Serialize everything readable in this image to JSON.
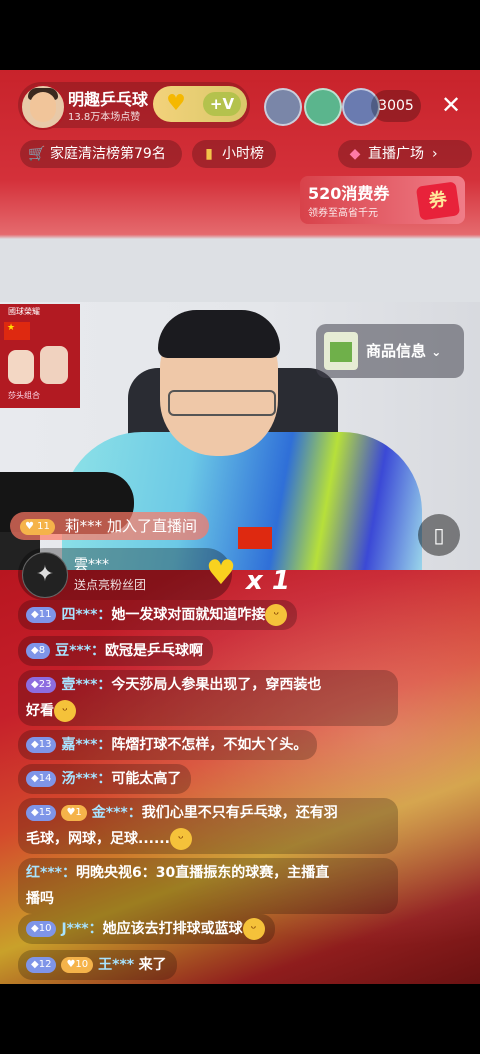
{
  "anchor": {
    "name": "明趣乒乓球",
    "likes": "13.8万本场点赞"
  },
  "viewers": {
    "count": "3005",
    "avatars": [
      "viewer-avatar-1",
      "viewer-avatar-2",
      "viewer-avatar-3"
    ]
  },
  "top_tags": {
    "rank_text": "家庭清洁榜第79名",
    "hourly_text": "小时榜",
    "plaza_text": "直播广场"
  },
  "coupon": {
    "title": "520消费券",
    "subtitle": "领券至高省千元",
    "tag": "券"
  },
  "goods": {
    "label": "商品信息"
  },
  "join": {
    "level": "11",
    "text": "莉*** 加入了直播间"
  },
  "fans": {
    "name": "雲***",
    "action": "送点亮粉丝团",
    "combo": "x 1"
  },
  "chat": [
    {
      "level": "11",
      "level_color": "blue",
      "user": "四***：",
      "content": "她一发球对面就知道咋接",
      "emoji": true
    },
    {
      "level": "8",
      "level_color": "blue",
      "user": "豆***：",
      "content": "欧冠是乒乓球啊",
      "emoji": false
    },
    {
      "level": "23",
      "level_color": "purple",
      "user": "壹***：",
      "content": "今天莎局人参果出现了，穿西装也",
      "content2": "好看",
      "emoji": true
    },
    {
      "level": "13",
      "level_color": "blue",
      "user": "嘉***：",
      "content": "阵熠打球不怎样，不如大丫头。",
      "emoji": false
    },
    {
      "level": "14",
      "level_color": "blue",
      "user": "汤***：",
      "content": "可能太高了",
      "emoji": false
    },
    {
      "level": "15",
      "level_color": "blue",
      "badge": "1",
      "user": "金***：",
      "content": "我们心里不只有乒乓球，还有羽",
      "content2": "毛球，网球，足球......",
      "emoji": true
    },
    {
      "level": "",
      "user": "红***：",
      "content": "明晚央视6：30直播振东的球赛，主播直",
      "content2": "播吗",
      "emoji": false
    },
    {
      "level": "10",
      "level_color": "blue",
      "user": "J***：",
      "content": "她应该去打排球或蓝球",
      "emoji": true
    },
    {
      "level": "12",
      "level_color": "blue",
      "badge": "10",
      "user": "王***",
      "content": "来了",
      "emoji": false
    }
  ],
  "icons": {
    "close": "close-icon",
    "chevron": "chevron-right-icon",
    "rotate": "rotate-screen-icon"
  },
  "colors": {
    "top_red": "#c8232b",
    "username_blue": "#a8e3ff",
    "gold": "#f5b34a"
  }
}
